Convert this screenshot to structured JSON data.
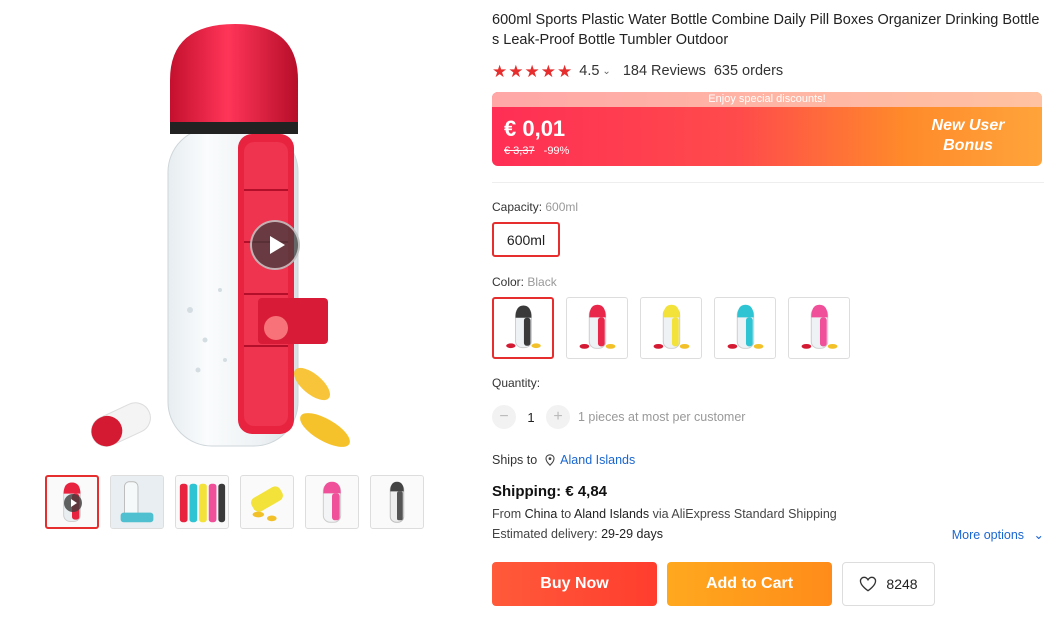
{
  "product": {
    "title": "600ml Sports Plastic Water Bottle Combine Daily Pill Boxes Organizer Drinking Bottles Leak-Proof Bottle Tumbler Outdoor",
    "rating_stars": 5,
    "rating_value": "4.5",
    "reviews": "184 Reviews",
    "orders": "635 orders"
  },
  "price": {
    "promo_text": "Enjoy special discounts!",
    "current": "€ 0,01",
    "original": "€ 3,37",
    "discount": "-99%",
    "bonus_line1": "New User",
    "bonus_line2": "Bonus"
  },
  "capacity": {
    "label": "Capacity:",
    "selected": "600ml",
    "option": "600ml"
  },
  "color": {
    "label": "Color:",
    "selected": "Black",
    "swatches": [
      "#3a3a3a",
      "#e8274a",
      "#f2e23a",
      "#2ec4d4",
      "#f0509a"
    ]
  },
  "quantity": {
    "label": "Quantity:",
    "minus": "−",
    "value": "1",
    "plus": "+",
    "note": "1 pieces at most per customer"
  },
  "shipping": {
    "ships_to_label": "Ships to",
    "ships_to_value": "Aland Islands",
    "title": "Shipping: € 4,84",
    "from_prefix": "From",
    "from_country": "China",
    "to_word": "to",
    "to_country": "Aland Islands",
    "via_text": "via AliExpress Standard Shipping",
    "delivery_label": "Estimated delivery:",
    "delivery_value": "29-29 days",
    "more_options": "More options"
  },
  "actions": {
    "buy_now": "Buy Now",
    "add_to_cart": "Add to Cart",
    "wishlist_count": "8248"
  },
  "colors": {
    "accent": "#e62e2e",
    "link": "#1a66d1"
  },
  "thumbnails": [
    "video-bottle-red",
    "bottle-clear",
    "bottles-multicolor",
    "pills-yellow",
    "bottle-pink",
    "bottle-black"
  ]
}
